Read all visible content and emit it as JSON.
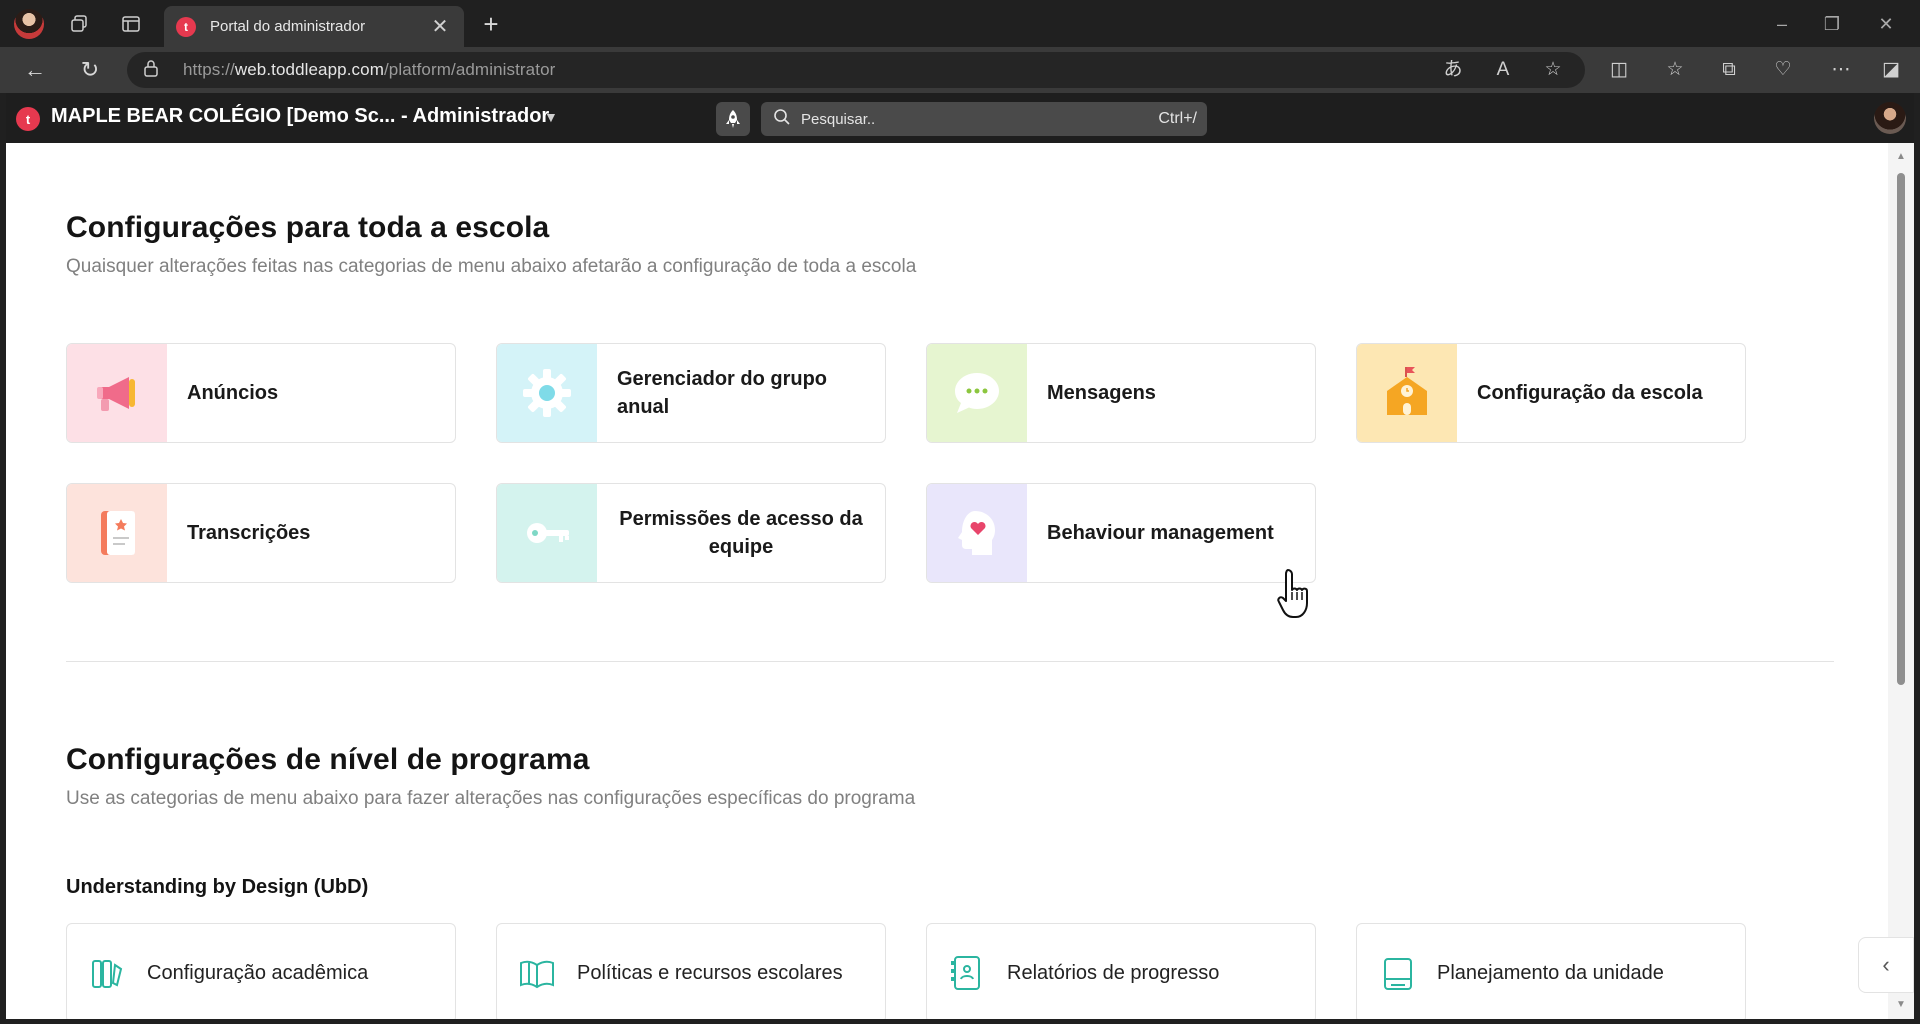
{
  "browser": {
    "tab_title": "Portal do administrador",
    "tab_favicon": "t",
    "url_prefix": "https://",
    "url_domain": "web.toddleapp.com",
    "url_path": "/platform/administrator",
    "new_tab_label": "+",
    "close_tab_label": "✕"
  },
  "app": {
    "logo_letter": "t",
    "school_name": "MAPLE BEAR COLÉGIO [Demo Sc... - Administrador",
    "search_placeholder": "Pesquisar..",
    "search_shortcut": "Ctrl+/"
  },
  "school_wide": {
    "title": "Configurações para toda a escola",
    "subtitle": "Quaisquer alterações feitas nas categorias de menu abaixo afetarão a configuração de toda a escola",
    "cards": [
      {
        "label": "Anúncios",
        "icon": "megaphone-icon",
        "bg": "#fde0e6"
      },
      {
        "label": "Gerenciador do grupo anual",
        "icon": "gear-icon",
        "bg": "#d4f3f8"
      },
      {
        "label": "Mensagens",
        "icon": "chat-bubble-icon",
        "bg": "#e6f5d0"
      },
      {
        "label": "Configuração da escola",
        "icon": "school-building-icon",
        "bg": "#fde7b3"
      },
      {
        "label": "Transcrições",
        "icon": "notebook-icon",
        "bg": "#fde3dc"
      },
      {
        "label": "Permissões de acesso da equipe",
        "icon": "key-icon",
        "bg": "#d4f3ee"
      },
      {
        "label": "Behaviour management",
        "icon": "head-heart-icon",
        "bg": "#e9e6fb"
      }
    ]
  },
  "program_level": {
    "title": "Configurações de nível de programa",
    "subtitle": "Use as categorias de menu abaixo para fazer alterações nas configurações específicas do programa",
    "group_title": "Understanding by Design (UbD)",
    "cards": [
      {
        "label": "Configuração acadêmica",
        "icon": "tools-icon"
      },
      {
        "label": "Políticas e recursos escolares",
        "icon": "open-book-icon"
      },
      {
        "label": "Relatórios de progresso",
        "icon": "report-icon"
      },
      {
        "label": "Planejamento da unidade",
        "icon": "planner-icon"
      }
    ]
  },
  "colors": {
    "accent": "#e6394f",
    "teal_icon": "#2bb5a0"
  }
}
